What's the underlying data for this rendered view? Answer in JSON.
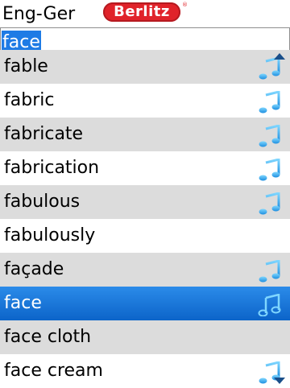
{
  "header": {
    "title": "Eng-Ger",
    "logo_text": "Berlitz",
    "logo_reg": "®"
  },
  "search": {
    "value": "face"
  },
  "list": {
    "items": [
      {
        "label": "fable",
        "audio": true
      },
      {
        "label": "fabric",
        "audio": true
      },
      {
        "label": "fabricate",
        "audio": true
      },
      {
        "label": "fabrication",
        "audio": true
      },
      {
        "label": "fabulous",
        "audio": true
      },
      {
        "label": "fabulously",
        "audio": false
      },
      {
        "label": "façade",
        "audio": true
      },
      {
        "label": "face",
        "audio": true,
        "selected": true
      },
      {
        "label": "face cloth",
        "audio": false
      },
      {
        "label": "face cream",
        "audio": true
      }
    ]
  },
  "colors": {
    "selection": "#1e7be5",
    "alt_row": "#dcdcdc",
    "logo": "#e0232a",
    "note": "#2aa8f0"
  }
}
